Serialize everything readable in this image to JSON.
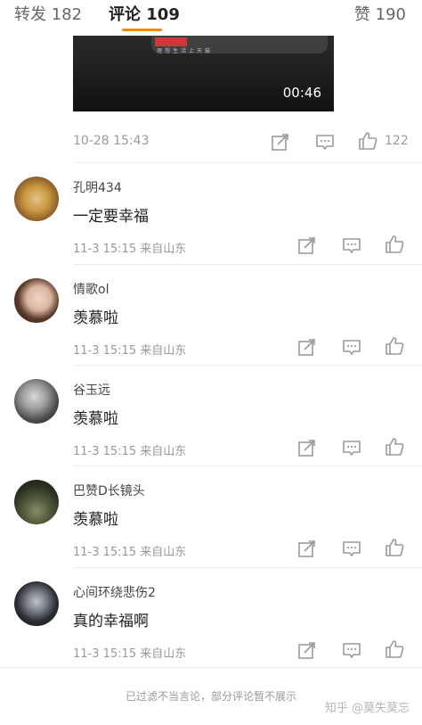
{
  "tabs": {
    "reposts": {
      "label": "转发",
      "count": "182"
    },
    "comments": {
      "label": "评论",
      "count": "109"
    },
    "likes": {
      "label": "赞",
      "count": "190"
    }
  },
  "post": {
    "video_duration": "00:46",
    "time": "10-28 15:43",
    "like_count": "122"
  },
  "comments": [
    {
      "user": "孔明434",
      "text": "一定要幸福",
      "time": "11-3 15:15  来自山东"
    },
    {
      "user": "情歌ol",
      "text": "羡慕啦",
      "time": "11-3 15:15  来自山东"
    },
    {
      "user": "谷玉远",
      "text": "羡慕啦",
      "time": "11-3 15:15  来自山东"
    },
    {
      "user": "巴赞D长镜头",
      "text": "羡慕啦",
      "time": "11-3 15:15  来自山东"
    },
    {
      "user": "心间环绕悲伤2",
      "text": "真的幸福啊",
      "time": "11-3 15:15  来自山东"
    }
  ],
  "footer": {
    "note": "已过滤不当言论，部分评论暂不展示",
    "watermark": "知乎 @莫失莫忘"
  },
  "icons": {
    "share": "share-icon",
    "comment": "comment-icon",
    "like": "thumbs-up-icon"
  },
  "colors": {
    "accent": "#ff8a00",
    "muted_text": "#999999",
    "icon_gray": "#9a9a9a"
  }
}
